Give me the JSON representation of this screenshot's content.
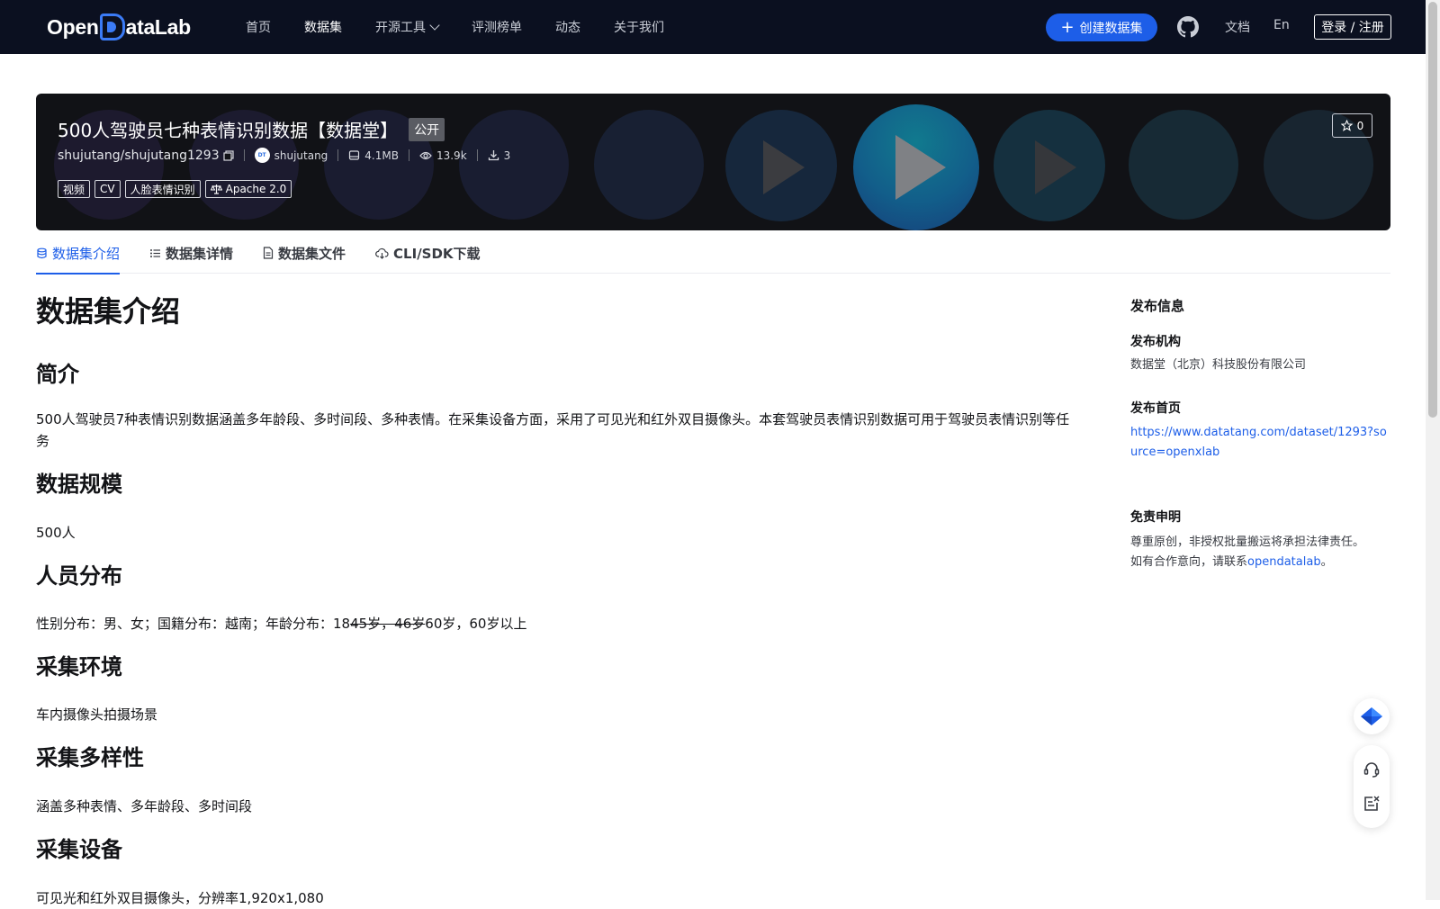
{
  "navbar": {
    "logo_text_left": "Open",
    "logo_text_right": "ataLab",
    "links": [
      {
        "label": "首页"
      },
      {
        "label": "数据集"
      },
      {
        "label": "开源工具"
      },
      {
        "label": "评测榜单"
      },
      {
        "label": "动态"
      },
      {
        "label": "关于我们"
      }
    ],
    "create_button": "创建数据集",
    "docs": "文档",
    "lang": "En",
    "login": "登录 / 注册"
  },
  "banner": {
    "title": "500人驾驶员七种表情识别数据【数据堂】",
    "visibility": "公开",
    "repo": "shujutang/shujutang1293",
    "owner": "shujutang",
    "size": "4.1MB",
    "views": "13.9k",
    "downloads": "3",
    "tags": [
      "视频",
      "CV",
      "人脸表情识别",
      "Apache 2.0"
    ],
    "stars": "0",
    "accent_color": "#1d5ee8"
  },
  "tabs": [
    {
      "label": "数据集介绍",
      "icon": "database-icon"
    },
    {
      "label": "数据集详情",
      "icon": "list-icon"
    },
    {
      "label": "数据集文件",
      "icon": "file-icon"
    },
    {
      "label": "CLI/SDK下载",
      "icon": "cloud-download-icon"
    }
  ],
  "content": {
    "heading": "数据集介绍",
    "sections": [
      {
        "title": "简介",
        "text": "500人驾驶员7种表情识别数据涵盖多年龄段、多时间段、多种表情。在采集设备方面，采用了可见光和红外双目摄像头。本套驾驶员表情识别数据可用于驾驶员表情识别等任务"
      },
      {
        "title": "数据规模",
        "text": "500人"
      },
      {
        "title": "人员分布",
        "text_before": "性别分布：男、女；国籍分布：越南；年龄分布：18",
        "text_struck": "45岁，46岁",
        "text_after": "60岁，60岁以上"
      },
      {
        "title": "采集环境",
        "text": "车内摄像头拍摄场景"
      },
      {
        "title": "采集多样性",
        "text": "涵盖多种表情、多年龄段、多时间段"
      },
      {
        "title": "采集设备",
        "text": "可见光和红外双目摄像头，分辨率1,920x1,080"
      }
    ]
  },
  "sidebar": {
    "title": "发布信息",
    "org_label": "发布机构",
    "org_value": "数据堂（北京）科技股份有限公司",
    "home_label": "发布首页",
    "home_url": "https://www.datatang.com/dataset/1293?source=openxlab",
    "disclaimer_label": "免责申明",
    "disclaimer_line1": "尊重原创，非授权批量搬运将承担法律责任。",
    "disclaimer_line2_prefix": "如有合作意向，请联系",
    "disclaimer_link": "opendatalab",
    "disclaimer_line2_suffix": "。"
  },
  "floating_buttons": [
    "diamond-logo-icon",
    "headset-icon",
    "feedback-icon"
  ]
}
